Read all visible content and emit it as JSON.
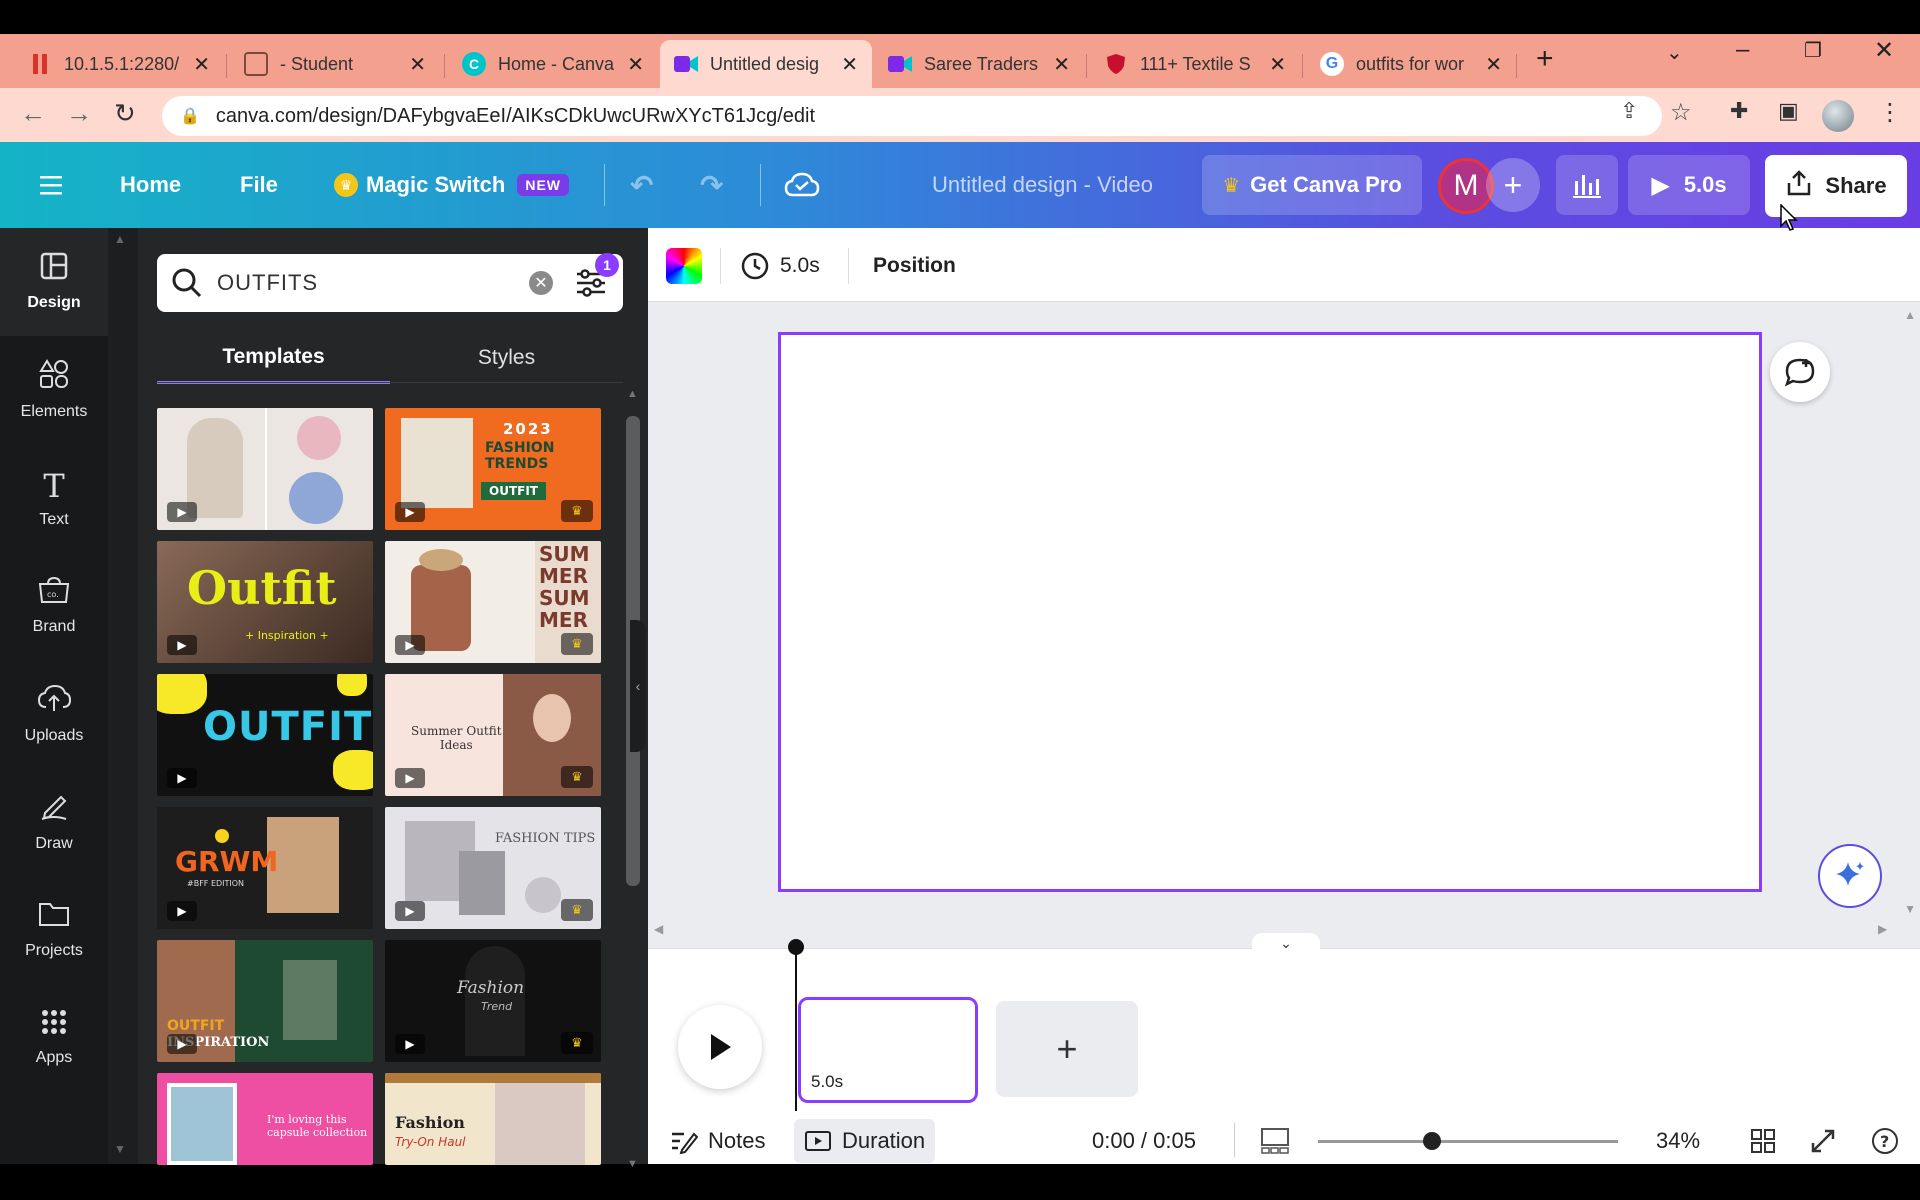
{
  "browser": {
    "tabs": [
      {
        "title": "10.1.5.1:2280/",
        "favicon_color": "#d9322b"
      },
      {
        "title": "- Student",
        "favicon_color": "#7a4a3a"
      },
      {
        "title": "Home - Canva",
        "favicon_color": "#00c4cc"
      },
      {
        "title": "Untitled desig",
        "favicon_color": "#7d2ae8"
      },
      {
        "title": "Saree Traders",
        "favicon_color": "#7d2ae8"
      },
      {
        "title": "111+ Textile S",
        "favicon_color": "#c8102e"
      },
      {
        "title": "outfits for wor",
        "favicon_color": "#4285f4"
      }
    ],
    "new_tab": "+",
    "url": "canva.com/design/DAFybgvaEeI/AIKsCDkUwcURwXYcT61Jcg/edit"
  },
  "header": {
    "menu_icon": "hamburger-icon",
    "home": "Home",
    "file": "File",
    "magic_switch": "Magic Switch",
    "new_badge": "NEW",
    "doc_title": "Untitled design - Video",
    "get_pro": "Get Canva Pro",
    "avatar_letter": "M",
    "play_duration": "5.0s",
    "share": "Share"
  },
  "rail": {
    "items": [
      {
        "label": "Design",
        "icon": "layout-icon"
      },
      {
        "label": "Elements",
        "icon": "shapes-icon"
      },
      {
        "label": "Text",
        "icon": "text-icon"
      },
      {
        "label": "Brand",
        "icon": "brand-icon"
      },
      {
        "label": "Uploads",
        "icon": "cloud-upload-icon"
      },
      {
        "label": "Draw",
        "icon": "pen-icon"
      },
      {
        "label": "Projects",
        "icon": "folder-icon"
      },
      {
        "label": "Apps",
        "icon": "apps-grid-icon"
      }
    ]
  },
  "panel": {
    "search_value": "OUTFITS",
    "filter_count": "1",
    "tabs": [
      "Templates",
      "Styles"
    ],
    "templates": [
      {
        "text": "",
        "bg": "#e9e4df",
        "crown": false
      },
      {
        "text": "2023 FASHION TRENDS OUTFIT",
        "bg": "#f06a1f",
        "crown": true
      },
      {
        "text": "Outfit",
        "sub": "Inspiration",
        "bg": "#6b4d3e",
        "crown": false
      },
      {
        "text": "SUM MER SUM MER",
        "bg": "#efe7df",
        "crown": true
      },
      {
        "text": "OUTFIT",
        "bg": "#111111",
        "crown": false
      },
      {
        "text": "Summer Outfit Ideas",
        "bg": "#f7e4dc",
        "crown": true
      },
      {
        "text": "GRWM",
        "sub": "#BFF EDITION",
        "bg": "#1d1d1d",
        "crown": false
      },
      {
        "text": "FASHION TIPS",
        "bg": "#e4e3e8",
        "crown": true
      },
      {
        "text": "OUTFIT INSPIRATION",
        "bg": "#1f4a32",
        "crown": false
      },
      {
        "text": "Fashion Trend",
        "bg": "#111111",
        "crown": true
      },
      {
        "text": "I'm loving this capsule collection",
        "bg": "#ef4fa3",
        "crown": false
      },
      {
        "text": "Fashion Try-On Haul",
        "bg": "#f1e5cc",
        "crown": false
      }
    ]
  },
  "editor": {
    "duration": "5.0s",
    "position": "Position",
    "clip_duration": "5.0s",
    "notes": "Notes",
    "duration_btn": "Duration",
    "time": "0:00 / 0:05",
    "zoom": "34%",
    "zoom_level": 0.38
  }
}
